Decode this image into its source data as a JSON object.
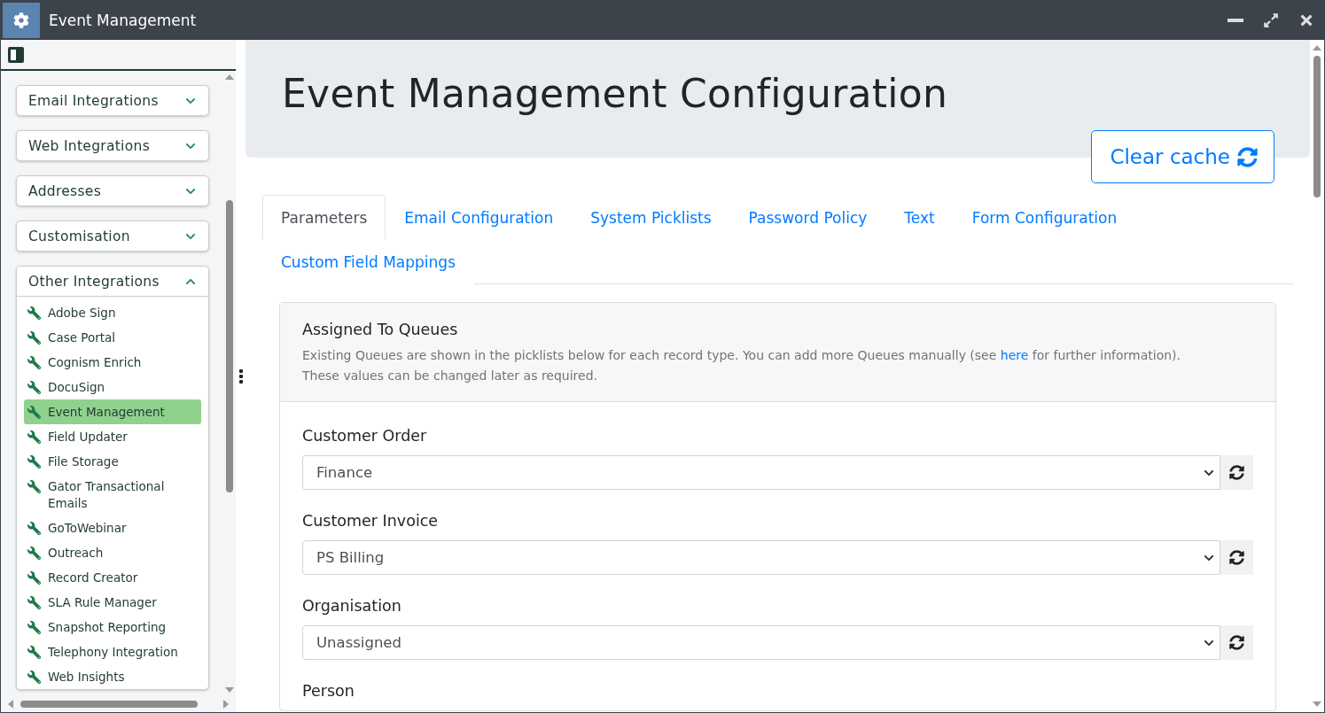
{
  "window": {
    "title": "Event Management"
  },
  "sidebar": {
    "groups": [
      {
        "label": "Email Integrations",
        "expanded": false
      },
      {
        "label": "Web Integrations",
        "expanded": false
      },
      {
        "label": "Addresses",
        "expanded": false
      },
      {
        "label": "Customisation",
        "expanded": false
      },
      {
        "label": "Other Integrations",
        "expanded": true,
        "items": [
          {
            "label": "Adobe Sign",
            "selected": false
          },
          {
            "label": "Case Portal",
            "selected": false
          },
          {
            "label": "Cognism Enrich",
            "selected": false
          },
          {
            "label": "DocuSign",
            "selected": false
          },
          {
            "label": "Event Management",
            "selected": true
          },
          {
            "label": "Field Updater",
            "selected": false
          },
          {
            "label": "File Storage",
            "selected": false
          },
          {
            "label": "Gator Transactional Emails",
            "selected": false
          },
          {
            "label": "GoToWebinar",
            "selected": false
          },
          {
            "label": "Outreach",
            "selected": false
          },
          {
            "label": "Record Creator",
            "selected": false
          },
          {
            "label": "SLA Rule Manager",
            "selected": false
          },
          {
            "label": "Snapshot Reporting",
            "selected": false
          },
          {
            "label": "Telephony Integration",
            "selected": false
          },
          {
            "label": "Web Insights",
            "selected": false
          }
        ]
      }
    ]
  },
  "page": {
    "title": "Event Management Configuration",
    "clear_cache_button": "Clear cache"
  },
  "tabs": [
    {
      "label": "Parameters",
      "selected": true
    },
    {
      "label": "Email Configuration",
      "selected": false
    },
    {
      "label": "System Picklists",
      "selected": false
    },
    {
      "label": "Password Policy",
      "selected": false
    },
    {
      "label": "Text",
      "selected": false
    },
    {
      "label": "Form Configuration",
      "selected": false
    },
    {
      "label": "Custom Field Mappings",
      "selected": false
    }
  ],
  "card": {
    "title": "Assigned To Queues",
    "description_before": "Existing Queues are shown in the picklists below for each record type. You can add more Queues manually (see ",
    "link": "here",
    "description_after": " for further information).",
    "note": "These values can be changed later as required.",
    "fields": [
      {
        "label": "Customer Order",
        "value": "Finance"
      },
      {
        "label": "Customer Invoice",
        "value": "PS Billing"
      },
      {
        "label": "Organisation",
        "value": "Unassigned"
      },
      {
        "label": "Person"
      }
    ]
  }
}
